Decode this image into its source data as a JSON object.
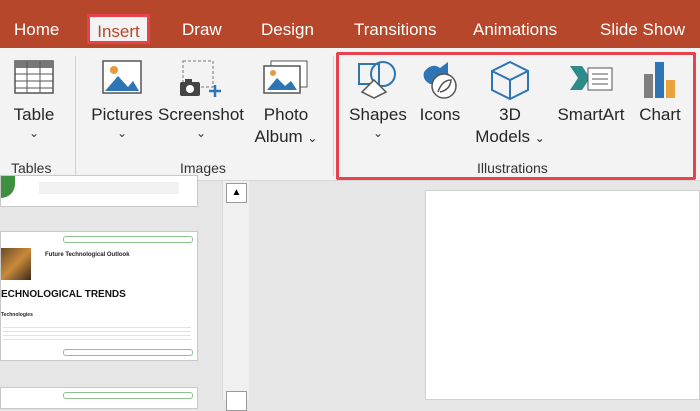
{
  "tabs": [
    {
      "label": "Home"
    },
    {
      "label": "Insert"
    },
    {
      "label": "Draw"
    },
    {
      "label": "Design"
    },
    {
      "label": "Transitions"
    },
    {
      "label": "Animations"
    },
    {
      "label": "Slide Show"
    }
  ],
  "groups": {
    "tables": {
      "label": "Tables",
      "table_label": "Table"
    },
    "images": {
      "label": "Images",
      "pictures_label": "Pictures",
      "screenshot_label": "Screenshot",
      "photo_album_line1": "Photo",
      "photo_album_line2": "Album"
    },
    "illustrations": {
      "label": "Illustrations",
      "shapes_label": "Shapes",
      "icons_label": "Icons",
      "models_line1": "3D",
      "models_line2": "Models",
      "smartart_label": "SmartArt",
      "chart_label": "Chart"
    }
  },
  "thumbnail": {
    "title": "Future Technological Outlook",
    "heading": "ECHNOLOGICAL TRENDS",
    "subheading": "Technologies"
  },
  "colors": {
    "accent": "#b7472a",
    "highlight": "#e8424f"
  }
}
